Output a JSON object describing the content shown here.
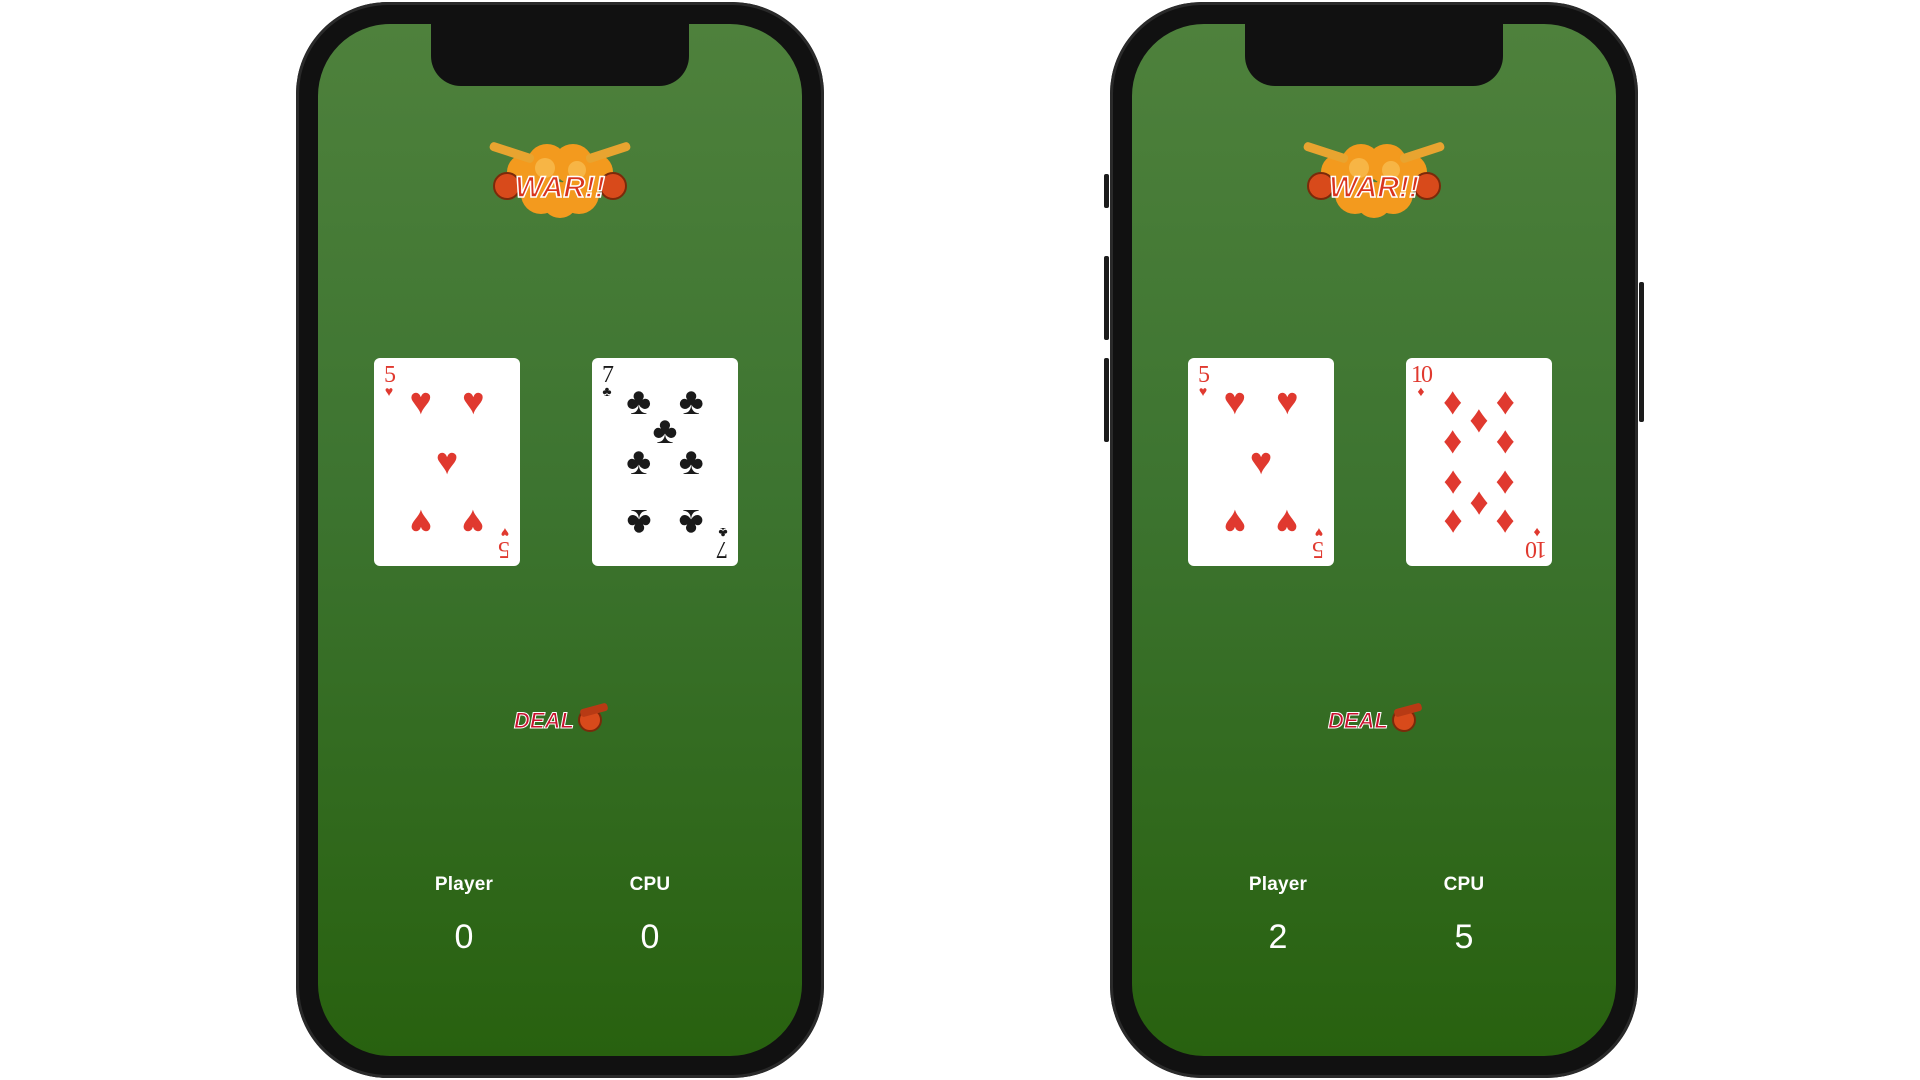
{
  "title": "WAR!!",
  "deal_label": "DEAL",
  "phones": [
    {
      "player_card": {
        "rank": "5",
        "suit": "hearts",
        "suit_symbol": "♥",
        "color": "#e0392f"
      },
      "cpu_card": {
        "rank": "7",
        "suit": "clubs",
        "suit_symbol": "♣",
        "color": "#1a1a1a"
      },
      "player_label": "Player",
      "cpu_label": "CPU",
      "player_score": "0",
      "cpu_score": "0"
    },
    {
      "player_card": {
        "rank": "5",
        "suit": "hearts",
        "suit_symbol": "♥",
        "color": "#e0392f"
      },
      "cpu_card": {
        "rank": "10",
        "suit": "diamonds",
        "suit_symbol": "♦",
        "color": "#e0392f"
      },
      "player_label": "Player",
      "cpu_label": "CPU",
      "player_score": "2",
      "cpu_score": "5"
    }
  ],
  "colors": {
    "table_green_top": "#4e813c",
    "table_green_bottom": "#28610f",
    "heart_red": "#e0392f",
    "club_black": "#1a1a1a",
    "logo_orange": "#f0901c",
    "deal_red": "#c8102e"
  }
}
